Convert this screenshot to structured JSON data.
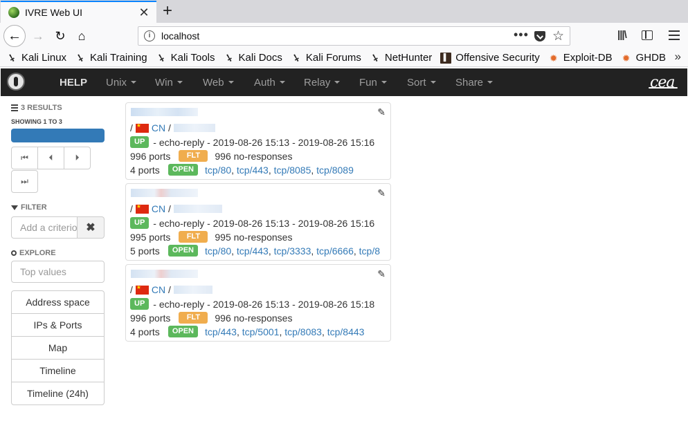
{
  "browser": {
    "tab_title": "IVRE Web UI",
    "url": "localhost",
    "bookmarks": [
      {
        "label": "Kali Linux",
        "icon": "kali-dragon-icon"
      },
      {
        "label": "Kali Training",
        "icon": "kali-dragon-icon"
      },
      {
        "label": "Kali Tools",
        "icon": "kali-dragon-icon"
      },
      {
        "label": "Kali Docs",
        "icon": "kali-dragon-icon"
      },
      {
        "label": "Kali Forums",
        "icon": "kali-dragon-icon"
      },
      {
        "label": "NetHunter",
        "icon": "kali-dragon-icon"
      },
      {
        "label": "Offensive Security",
        "icon": "offsec-icon"
      },
      {
        "label": "Exploit-DB",
        "icon": "exploit-db-icon"
      },
      {
        "label": "GHDB",
        "icon": "exploit-db-icon"
      }
    ]
  },
  "nav": {
    "help": "HELP",
    "menus": [
      "Unix",
      "Win",
      "Web",
      "Auth",
      "Relay",
      "Fun",
      "Sort",
      "Share"
    ]
  },
  "sidebar": {
    "results_label": "3 RESULTS",
    "showing_label": "SHOWING 1 TO 3",
    "progress": 1.0,
    "filter_label": "FILTER",
    "filter_placeholder": "Add a criterion",
    "explore_label": "EXPLORE",
    "explore_placeholder": "Top values",
    "buttons": [
      "Address space",
      "IPs & Ports",
      "Map",
      "Timeline",
      "Timeline (24h)"
    ]
  },
  "results": [
    {
      "country": "CN",
      "status": "UP",
      "reason": "echo-reply",
      "times": "2019-08-26 15:13 - 2019-08-26 15:16",
      "ports_count": "996 ports",
      "flt_label": "FLT",
      "no_responses": "996 no-responses",
      "open_count": "4 ports",
      "open_label": "OPEN",
      "ports": [
        "tcp/80",
        "tcp/443",
        "tcp/8085",
        "tcp/8089"
      ]
    },
    {
      "country": "CN",
      "status": "UP",
      "reason": "echo-reply",
      "times": "2019-08-26 15:13 - 2019-08-26 15:16",
      "ports_count": "995 ports",
      "flt_label": "FLT",
      "no_responses": "995 no-responses",
      "open_count": "5 ports",
      "open_label": "OPEN",
      "ports": [
        "tcp/80",
        "tcp/443",
        "tcp/3333",
        "tcp/6666",
        "tcp/8"
      ]
    },
    {
      "country": "CN",
      "status": "UP",
      "reason": "echo-reply",
      "times": "2019-08-26 15:13 - 2019-08-26 15:18",
      "ports_count": "996 ports",
      "flt_label": "FLT",
      "no_responses": "996 no-responses",
      "open_count": "4 ports",
      "open_label": "OPEN",
      "ports": [
        "tcp/443",
        "tcp/5001",
        "tcp/8083",
        "tcp/8443"
      ]
    }
  ]
}
